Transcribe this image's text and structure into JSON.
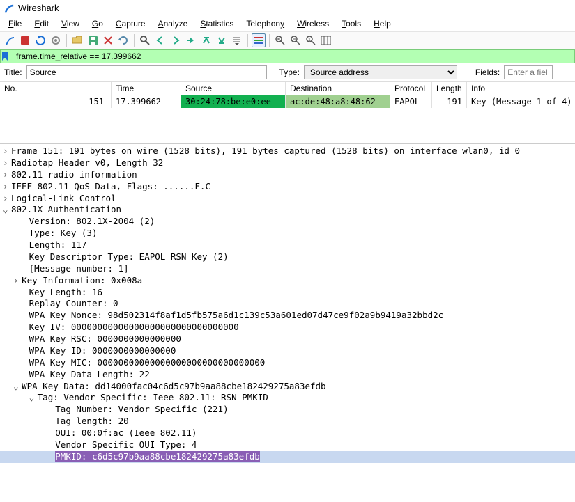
{
  "app": {
    "title": "Wireshark"
  },
  "menu": {
    "file": "File",
    "edit": "Edit",
    "view": "View",
    "go": "Go",
    "capture": "Capture",
    "analyze": "Analyze",
    "statistics": "Statistics",
    "telephony": "Telephony",
    "wireless": "Wireless",
    "tools": "Tools",
    "help": "Help"
  },
  "filter": {
    "value": "frame.time_relative == 17.399662"
  },
  "titlebar2": {
    "title_label": "Title:",
    "title_value": "Source",
    "type_label": "Type:",
    "type_value": "Source address",
    "fields_label": "Fields:",
    "fields_placeholder": "Enter a fiel"
  },
  "columns": {
    "no": "No.",
    "time": "Time",
    "src": "Source",
    "dst": "Destination",
    "proto": "Protocol",
    "len": "Length",
    "info": "Info"
  },
  "row": {
    "no": "151",
    "time": "17.399662",
    "src": "30:24:78:be:e0:ee",
    "dst": "ac:de:48:a8:48:62",
    "proto": "EAPOL",
    "len": "191",
    "info": "Key (Message 1 of 4)"
  },
  "tree": {
    "frame": "Frame 151: 191 bytes on wire (1528 bits), 191 bytes captured (1528 bits) on interface wlan0, id 0",
    "radiotap": "Radiotap Header v0, Length 32",
    "radio": "802.11 radio information",
    "qos": "IEEE 802.11 QoS Data, Flags: ......F.C",
    "llc": "Logical-Link Control",
    "eapol": "802.1X Authentication",
    "version": "Version: 802.1X-2004 (2)",
    "type": "Type: Key (3)",
    "length": "Length: 117",
    "kdt": "Key Descriptor Type: EAPOL RSN Key (2)",
    "msgnum": "[Message number: 1]",
    "keyinfo": "Key Information: 0x008a",
    "keylen": "Key Length: 16",
    "replay": "Replay Counter: 0",
    "nonce": "WPA Key Nonce: 98d502314f8af1d5fb575a6d1c139c53a601ed07d47ce9f02a9b9419a32bbd2c",
    "iv": "Key IV: 00000000000000000000000000000000",
    "rsc": "WPA Key RSC: 0000000000000000",
    "id": "WPA Key ID: 0000000000000000",
    "mic": "WPA Key MIC: 00000000000000000000000000000000",
    "kdlen": "WPA Key Data Length: 22",
    "kdata": "WPA Key Data: dd14000fac04c6d5c97b9aa88cbe182429275a83efdb",
    "tag": "Tag: Vendor Specific: Ieee 802.11: RSN PMKID",
    "tagnum": "Tag Number: Vendor Specific (221)",
    "taglen": "Tag length: 20",
    "oui": "OUI: 00:0f:ac (Ieee 802.11)",
    "ouitype": "Vendor Specific OUI Type: 4",
    "pmkid": "PMKID: c6d5c97b9aa88cbe182429275a83efdb"
  }
}
